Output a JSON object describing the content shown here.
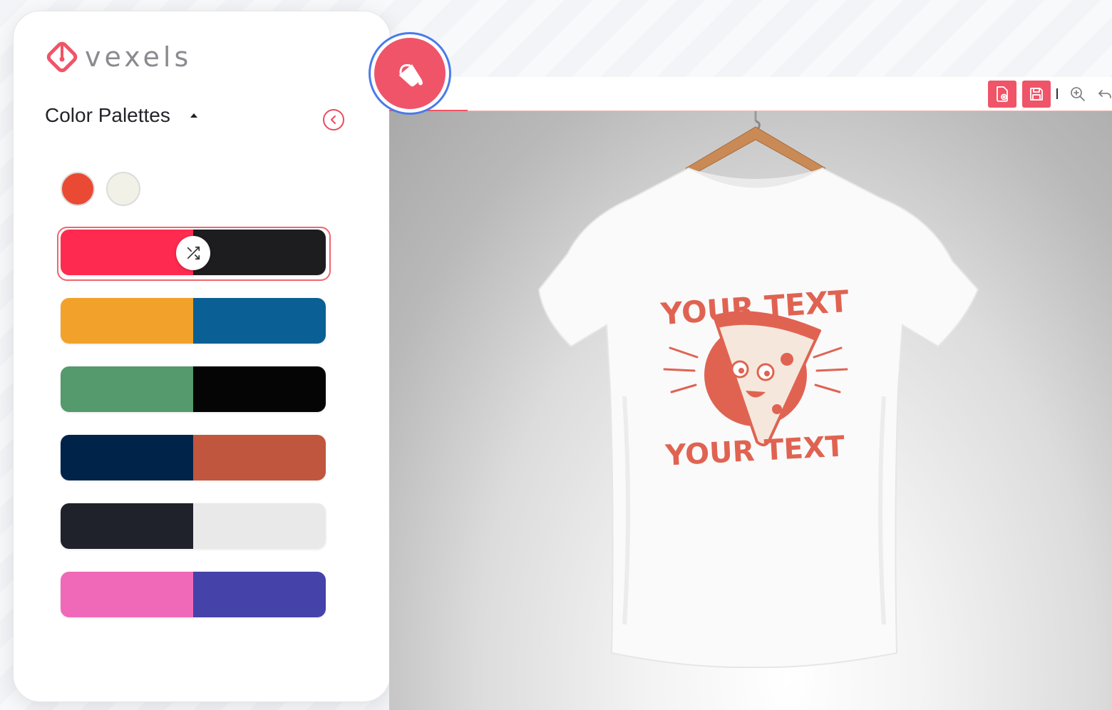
{
  "brand": {
    "name": "vexels",
    "color": "#f05468"
  },
  "sidebar": {
    "section_title": "Color Palettes",
    "collapse_icon": "chevron-left-icon",
    "selected_swatches": [
      {
        "color": "#ea4a34"
      },
      {
        "color": "#f2f1e7"
      }
    ],
    "palettes": [
      {
        "colors": [
          "#ff2a4f",
          "#1d1d1f"
        ],
        "selected": true
      },
      {
        "colors": [
          "#f2a22a",
          "#0a6094"
        ],
        "selected": false
      },
      {
        "colors": [
          "#559a6c",
          "#050505"
        ],
        "selected": false
      },
      {
        "colors": [
          "#00234a",
          "#c1563e"
        ],
        "selected": false
      },
      {
        "colors": [
          "#1f222b",
          "#e9e9e9"
        ],
        "selected": false
      },
      {
        "colors": [
          "#f069b9",
          "#4542aa"
        ],
        "selected": false
      }
    ],
    "shuffle_icon": "shuffle-icon"
  },
  "floating_button": {
    "icon": "paint-bucket-icon",
    "color": "#f05468"
  },
  "toolbar": {
    "buttons": [
      {
        "icon": "new-document-icon"
      },
      {
        "icon": "save-icon"
      }
    ],
    "icons": [
      "zoom-in-icon",
      "undo-icon"
    ]
  },
  "canvas": {
    "design_top_text": "YOUR TEXT",
    "design_bottom_text": "YOUR TEXT",
    "design_color": "#e06352",
    "shirt_color": "#fafafa"
  }
}
